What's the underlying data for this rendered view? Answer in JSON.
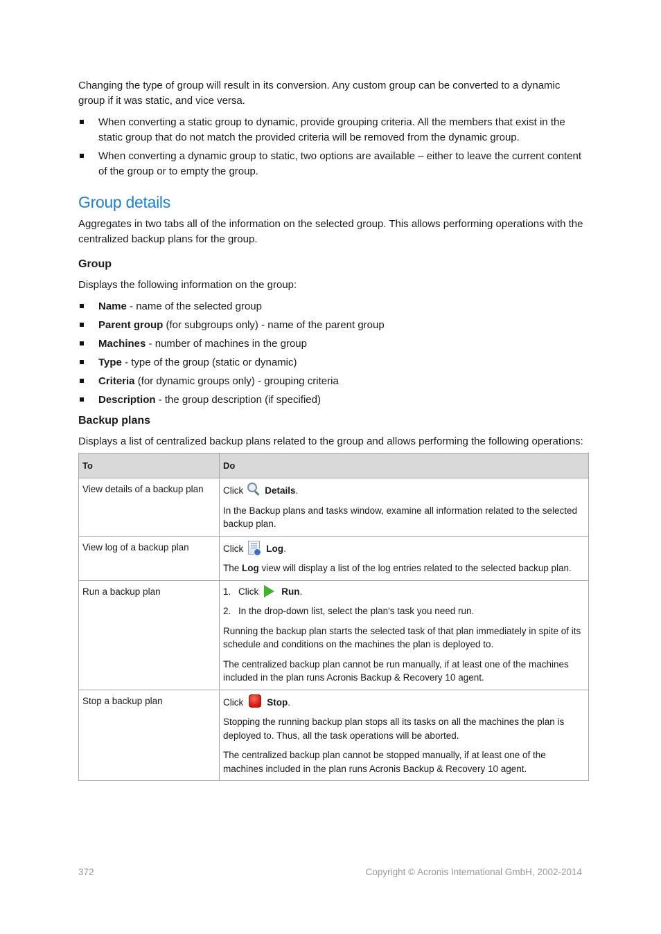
{
  "intro": {
    "paragraph": "Changing the type of group will result in its conversion. Any custom group can be converted to a dynamic group if it was static, and vice versa.",
    "bullets": [
      "When converting a static group to dynamic, provide grouping criteria. All the members that exist in the static group that do not match the provided criteria will be removed from the dynamic group.",
      "When converting a dynamic group to static, two options are available – either to leave the current content of the group or to empty the group."
    ]
  },
  "section": {
    "title": "Group details",
    "description": "Aggregates in two tabs all of the information on the selected group. This allows performing operations with the centralized backup plans for the group."
  },
  "group": {
    "heading": "Group",
    "lead": "Displays the following information on the group:",
    "fields": [
      {
        "term": "Name",
        "text": " - name of the selected group"
      },
      {
        "term": "Parent group",
        "text": " (for subgroups only) - name of the parent group"
      },
      {
        "term": "Machines",
        "text": " - number of machines in the group"
      },
      {
        "term": "Type",
        "text": " - type of the group (static or dynamic)"
      },
      {
        "term": "Criteria",
        "text": " (for dynamic groups only) - grouping criteria"
      },
      {
        "term": "Description",
        "text": " - the group description (if specified)"
      }
    ]
  },
  "backup_plans": {
    "heading": "Backup plans",
    "lead": "Displays a list of centralized backup plans related to the group and allows performing the following operations:",
    "table": {
      "headers": [
        "To",
        "Do"
      ],
      "rows": [
        {
          "to": "View details of a backup plan",
          "click": "Click",
          "icon": "magnifier-icon",
          "action": "Details",
          "notes": [
            "In the Backup plans and tasks window, examine all information related to the selected backup plan."
          ]
        },
        {
          "to": "View log of a backup plan",
          "click": "Click",
          "icon": "log-icon",
          "action": "Log",
          "note_prefix": "The ",
          "note_bold": "Log",
          "note_suffix": " view will display a list of the log entries related to the selected backup plan."
        },
        {
          "to": "Run a backup plan",
          "step1_num": "1.",
          "click": "Click",
          "icon": "play-icon",
          "action": "Run",
          "step2_num": "2.",
          "step2": "In the drop-down list, select the plan's task you need run.",
          "notes": [
            "Running the backup plan starts the selected task of that plan immediately in spite of its schedule and conditions on the machines the plan is deployed to.",
            "The centralized backup plan cannot be run manually, if at least one of the machines included in the plan runs Acronis Backup & Recovery 10 agent."
          ]
        },
        {
          "to": "Stop a backup plan",
          "click": "Click",
          "icon": "stop-icon",
          "action": "Stop",
          "notes": [
            "Stopping the running backup plan stops all its tasks on all the machines the plan is deployed to. Thus, all the task operations will be aborted.",
            "The centralized backup plan cannot be stopped manually, if at least one of the machines included in the plan runs Acronis Backup & Recovery 10 agent."
          ]
        }
      ]
    }
  },
  "footer": {
    "page_number": "372",
    "copyright": "Copyright © Acronis International GmbH, 2002-2014"
  },
  "colors": {
    "heading_blue": "#1f7fc6",
    "table_header_bg": "#d9d9d9",
    "footer_gray": "#9a9a9a"
  },
  "punct": "."
}
